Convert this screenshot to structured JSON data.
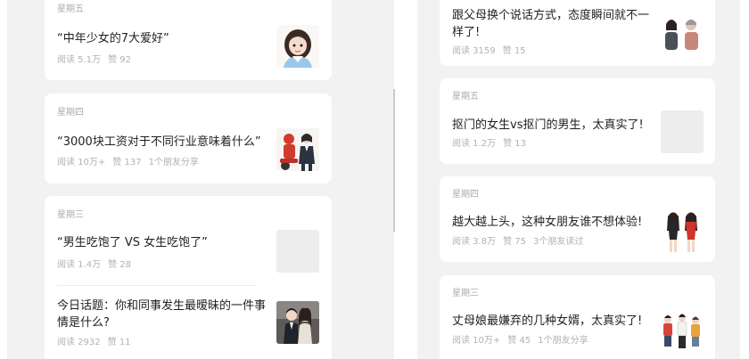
{
  "left_feed": {
    "cards": [
      {
        "weekday": "星期五",
        "articles": [
          {
            "title": "“中年少女的7大爱好”",
            "reads": "阅读 5.1万",
            "likes": "赞 92",
            "extra": ""
          }
        ]
      },
      {
        "weekday": "星期四",
        "articles": [
          {
            "title": "“3000块工资对于不同行业意味着什么”",
            "reads": "阅读 10万+",
            "likes": "赞 137",
            "extra": "1个朋友分享"
          }
        ]
      },
      {
        "weekday": "星期三",
        "articles": [
          {
            "title": "“男生吃饱了 VS 女生吃饱了”",
            "reads": "阅读 1.4万",
            "likes": "赞 28",
            "extra": ""
          },
          {
            "title": "今日话题：你和同事发生最暧昧的一件事情是什么?",
            "reads": "阅读 2932",
            "likes": "赞 11",
            "extra": ""
          }
        ]
      }
    ]
  },
  "right_feed": {
    "cards": [
      {
        "weekday": "",
        "articles": [
          {
            "title": "跟父母换个说话方式，态度瞬间就不一样了!",
            "reads": "阅读 3159",
            "likes": "赞 15",
            "extra": ""
          }
        ]
      },
      {
        "weekday": "星期五",
        "articles": [
          {
            "title": "抠门的女生vs抠门的男生，太真实了!",
            "reads": "阅读 1.2万",
            "likes": "赞 13",
            "extra": ""
          }
        ]
      },
      {
        "weekday": "星期四",
        "articles": [
          {
            "title": "越大越上头，这种女朋友谁不想体验!",
            "reads": "阅读 3.8万",
            "likes": "赞 75",
            "extra": "3个朋友读过"
          }
        ]
      },
      {
        "weekday": "星期三",
        "articles": [
          {
            "title": "丈母娘最嫌弃的几种女婿，太真实了!",
            "reads": "阅读 10万+",
            "likes": "赞 45",
            "extra": "1个朋友分享"
          }
        ]
      }
    ]
  },
  "colors": {
    "panel_bg": "#f2f2f2",
    "card_bg": "#ffffff",
    "weekday_text": "#ababab",
    "meta_text": "#b2b2b2",
    "title_text": "#1f1f1f"
  },
  "thumbnails": [
    "girl-portrait-illustration",
    "delivery-rider-and-businesswoman-illustration",
    "placeholder",
    "couple-portrait-illustration",
    "parents-and-child-illustration",
    "placeholder",
    "two-women-dresses-illustration",
    "family-group-illustration"
  ]
}
